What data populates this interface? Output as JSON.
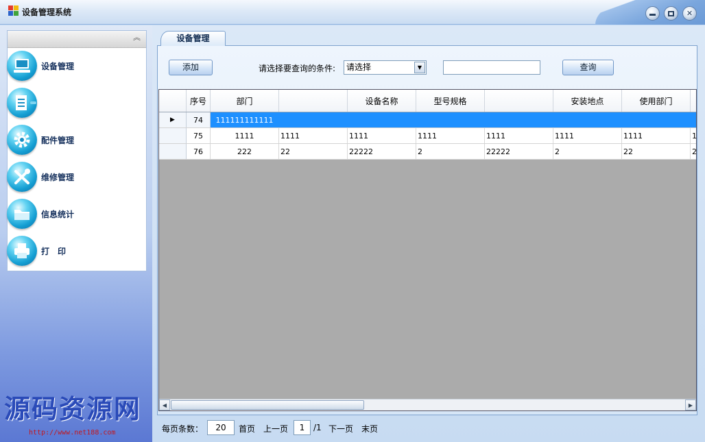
{
  "window": {
    "title": "设备管理系统"
  },
  "sidebar": {
    "items": [
      {
        "label": "设备管理",
        "icon": "computer-icon"
      },
      {
        "label": "",
        "icon": "document-icon"
      },
      {
        "label": "配件管理",
        "icon": "gear-icon"
      },
      {
        "label": "维修管理",
        "icon": "tools-icon"
      },
      {
        "label": "信息统计",
        "icon": "folder-icon"
      },
      {
        "label": "打　印",
        "icon": "printer-icon"
      }
    ]
  },
  "watermark": {
    "text": "源码资源网",
    "url": "http://www.net188.com"
  },
  "main": {
    "tab_label": "设备管理",
    "add_button": "添加",
    "condition_label": "请选择要查询的条件:",
    "condition_select": "请选择",
    "search_value": "",
    "search_button": "查询"
  },
  "grid": {
    "columns": [
      "序号",
      "部门",
      "",
      "设备名称",
      "型号规格",
      "",
      "安装地点",
      "使用部门"
    ],
    "rows": [
      {
        "id": "74",
        "cells": [
          "111111111111",
          "",
          "",
          "",
          "",
          "",
          "",
          ""
        ]
      },
      {
        "id": "75",
        "cells": [
          "1111",
          "1111",
          "1111",
          "1111",
          "1111",
          "1111",
          "1111",
          "1"
        ]
      },
      {
        "id": "76",
        "cells": [
          "222",
          "22",
          "22222",
          "2",
          "22222",
          "2",
          "22",
          "2"
        ]
      }
    ]
  },
  "pager": {
    "per_page_label": "每页条数：",
    "per_page": "20",
    "first": "首页",
    "prev": "上一页",
    "current": "1",
    "total": "/1",
    "next": "下一页",
    "last": "末页"
  },
  "colors": {
    "selection": "#1e90ff",
    "icon_blue": "#159fd3",
    "watermark": "#2a4ab8"
  }
}
